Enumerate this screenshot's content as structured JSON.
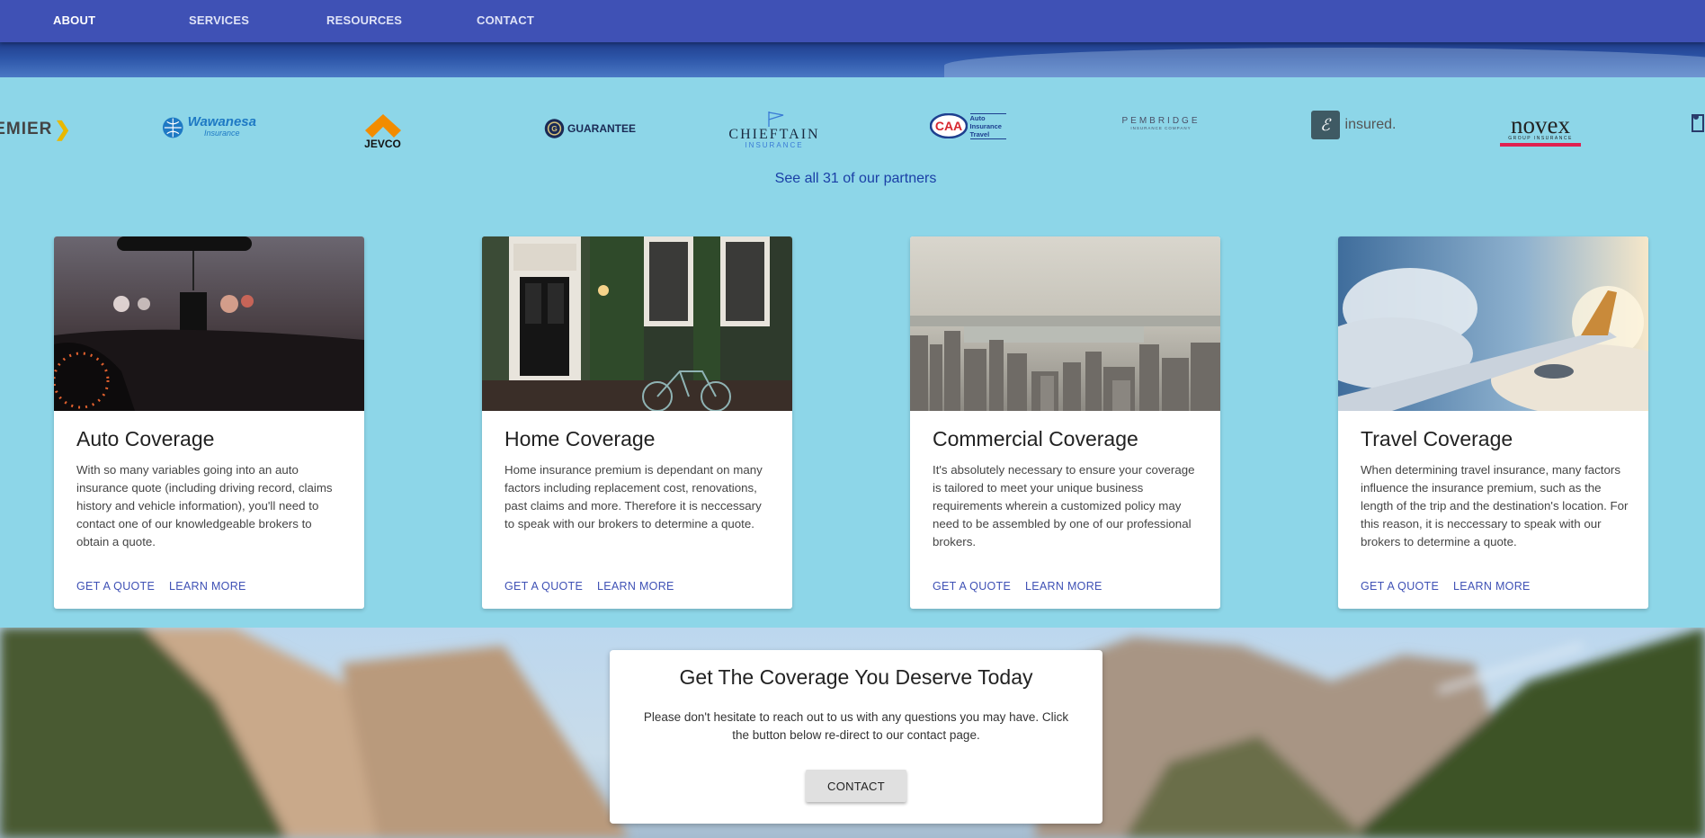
{
  "nav": {
    "items": [
      {
        "label": "ABOUT"
      },
      {
        "label": "SERVICES"
      },
      {
        "label": "RESOURCES"
      },
      {
        "label": "CONTACT"
      }
    ]
  },
  "partners": {
    "logos": [
      {
        "text": "EMIER",
        "icon": "premier-logo"
      },
      {
        "text": "Wawanesa",
        "sub": "Insurance",
        "icon": "wawanesa-logo"
      },
      {
        "text": "JEVCO",
        "icon": "jevco-logo"
      },
      {
        "text": "GUARANTEE",
        "icon": "guarantee-logo"
      },
      {
        "text": "CHIEFTAIN",
        "sub": "INSURANCE",
        "icon": "chieftain-logo"
      },
      {
        "text": "CAA",
        "sub": "Auto Insurance Travel",
        "icon": "caa-logo"
      },
      {
        "text": "PEMBRIDGE",
        "sub": "INSURANCE COMPANY",
        "icon": "pembridge-logo"
      },
      {
        "text": "insured.",
        "icon": "insured-logo"
      },
      {
        "text": "novex",
        "sub": "GROUP INSURANCE",
        "icon": "novex-logo"
      }
    ],
    "see_all": "See all 31 of our partners"
  },
  "cards": [
    {
      "title": "Auto Coverage",
      "body": "With so many variables going into an auto insurance quote (including driving record, claims history and vehicle information), you'll need to contact one of our knowledgeable brokers to obtain a quote.",
      "quote": "GET A QUOTE",
      "learn": "LEARN MORE"
    },
    {
      "title": "Home Coverage",
      "body": "Home insurance premium is dependant on many factors including replacement cost, renovations, past claims and more. Therefore it is neccessary to speak with our brokers to determine a quote.",
      "quote": "GET A QUOTE",
      "learn": "LEARN MORE"
    },
    {
      "title": "Commercial Coverage",
      "body": "It's absolutely necessary to ensure your coverage is tailored to meet your unique business requirements wherein a customized policy may need to be assembled by one of our professional brokers.",
      "quote": "GET A QUOTE",
      "learn": "LEARN MORE"
    },
    {
      "title": "Travel Coverage",
      "body": "When determining travel insurance, many factors influence the insurance premium, such as the length of the trip and the destination's location. For this reason, it is neccessary to speak with our brokers to determine a quote.",
      "quote": "GET A QUOTE",
      "learn": "LEARN MORE"
    }
  ],
  "cta": {
    "title": "Get The Coverage You Deserve Today",
    "body": "Please don't hesitate to reach out to us with any questions you may have. Click the button below re-direct to our contact page.",
    "button": "CONTACT"
  },
  "colors": {
    "nav": "#3f51b5",
    "background": "#8dd6e8",
    "link": "#3f51b5"
  }
}
